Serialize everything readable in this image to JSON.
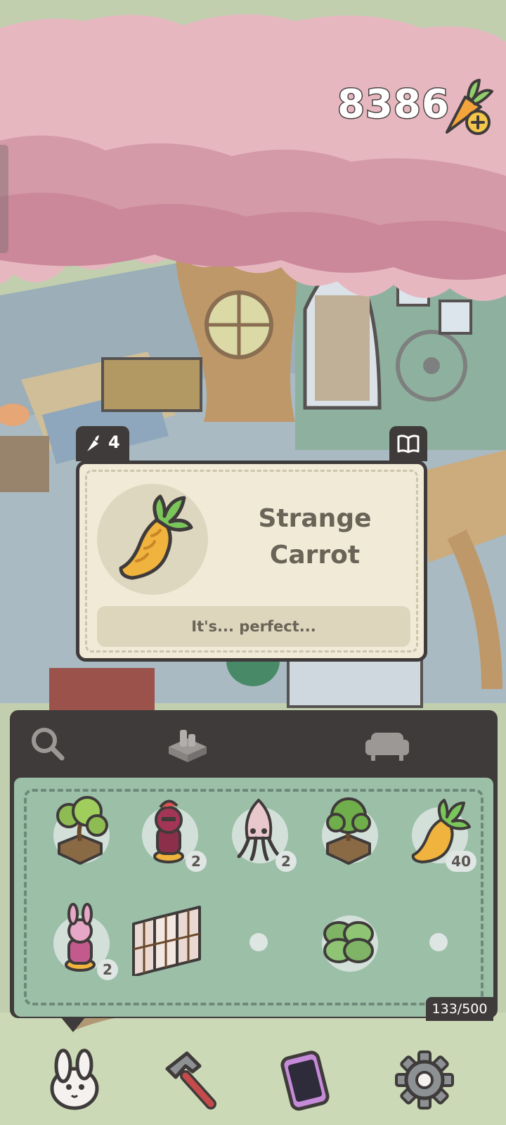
{
  "currency": {
    "amount": "8386",
    "icon": "carrot-plus-icon"
  },
  "item_card": {
    "price": "4",
    "price_icon": "carrot-icon",
    "codex_icon": "book-icon",
    "name_line1": "Strange",
    "name_line2": "Carrot",
    "description": "It's... perfect..."
  },
  "inventory": {
    "tabs": [
      {
        "id": "search",
        "icon": "search-icon"
      },
      {
        "id": "decor",
        "icon": "decor-icon"
      },
      {
        "id": "furniture",
        "icon": "sofa-icon"
      }
    ],
    "slots": [
      {
        "item": "bonsai-planter",
        "count": ""
      },
      {
        "item": "red-knight-figurine",
        "count": "2"
      },
      {
        "item": "squid-figurine",
        "count": "2"
      },
      {
        "item": "bonsai-planter",
        "count": ""
      },
      {
        "item": "strange-carrot",
        "count": "40"
      },
      {
        "item": "pink-bunny-figurine",
        "count": "2"
      },
      {
        "item": "folding-screen",
        "count": ""
      },
      {
        "item": "empty",
        "count": ""
      },
      {
        "item": "clover-plant",
        "count": ""
      },
      {
        "item": "empty",
        "count": ""
      }
    ],
    "capacity": "133/500"
  },
  "bottom_nav": [
    {
      "id": "bunny",
      "icon": "bunny-icon"
    },
    {
      "id": "build",
      "icon": "hammer-icon"
    },
    {
      "id": "phone",
      "icon": "phone-icon"
    },
    {
      "id": "settings",
      "icon": "gear-icon"
    }
  ],
  "colors": {
    "panel": "#3f3b3a",
    "card": "#f1ead6",
    "grid": "#9cbfa8",
    "foliage": "#e4aeb8"
  }
}
